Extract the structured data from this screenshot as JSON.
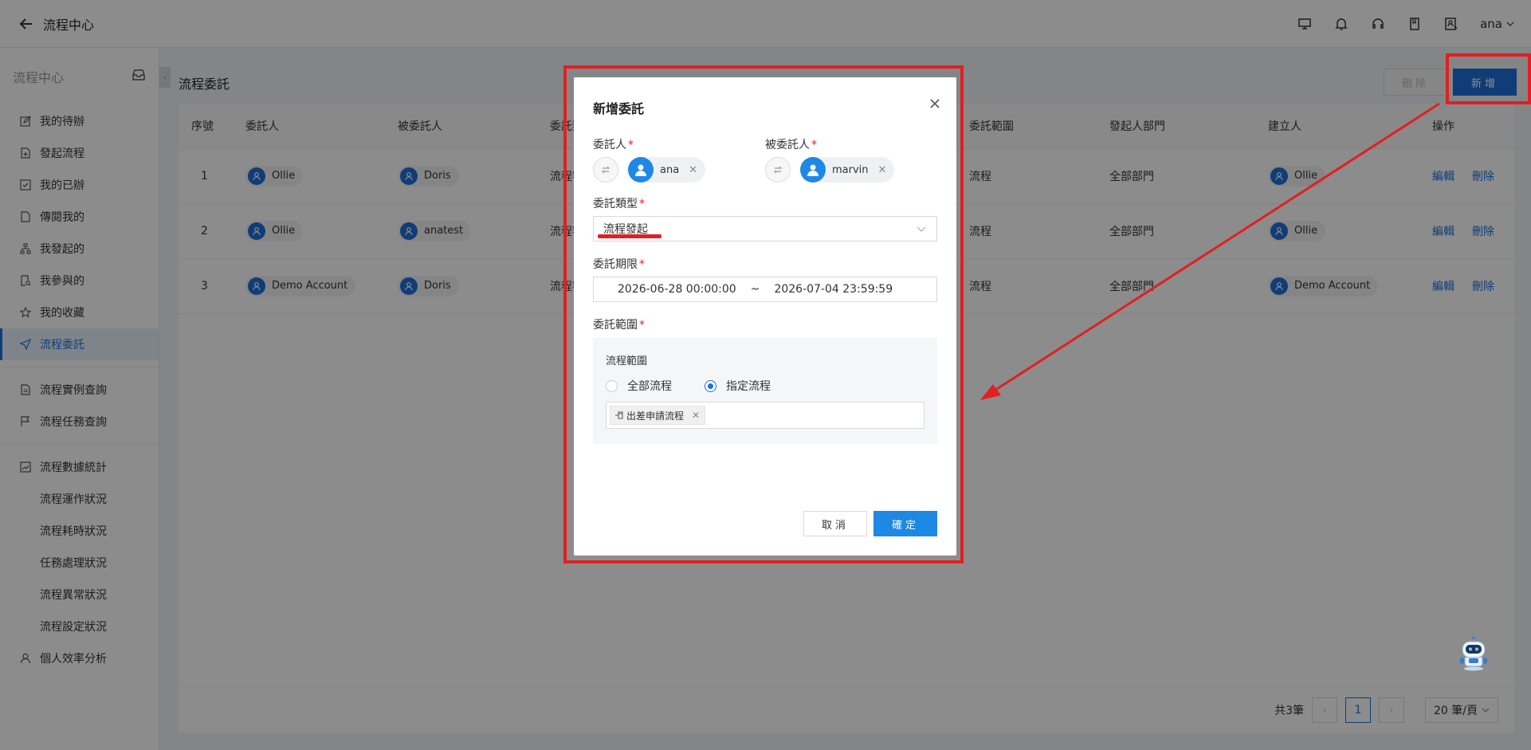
{
  "header": {
    "title": "流程中心",
    "user": "ana"
  },
  "sidebar": {
    "head": "流程中心",
    "items": [
      {
        "label": "我的待辦"
      },
      {
        "label": "發起流程"
      },
      {
        "label": "我的已辦"
      },
      {
        "label": "傳閱我的"
      },
      {
        "label": "我發起的"
      },
      {
        "label": "我參與的"
      },
      {
        "label": "我的收藏"
      },
      {
        "label": "流程委託"
      },
      {
        "label": "流程實例查詢"
      },
      {
        "label": "流程任務查詢"
      },
      {
        "label": "流程數據統計"
      },
      {
        "label": "流程運作狀況"
      },
      {
        "label": "流程耗時狀況"
      },
      {
        "label": "任務處理狀況"
      },
      {
        "label": "流程異常狀況"
      },
      {
        "label": "流程設定狀況"
      },
      {
        "label": "個人效率分析"
      }
    ]
  },
  "page": {
    "title": "流程委託",
    "delete_label": "刪除",
    "add_label": "新增"
  },
  "table": {
    "columns": [
      "序號",
      "委託人",
      "被委託人",
      "委託類型",
      "委託範圍",
      "發起人部門",
      "建立人",
      "操作"
    ],
    "rows": [
      {
        "no": "1",
        "delegator": "Ollie",
        "delegate": "Doris",
        "type": "流程審",
        "scope": "流程",
        "dept": "全部部門",
        "creator": "Ollie",
        "edit": "編輯",
        "del": "刪除"
      },
      {
        "no": "2",
        "delegator": "Ollie",
        "delegate": "anatest",
        "type": "流程審",
        "scope": "流程",
        "dept": "全部部門",
        "creator": "Ollie",
        "edit": "編輯",
        "del": "刪除"
      },
      {
        "no": "3",
        "delegator": "Demo Account",
        "delegate": "Doris",
        "type": "流程審",
        "scope": "流程",
        "dept": "全部部門",
        "creator": "Demo Account",
        "edit": "編輯",
        "del": "刪除"
      }
    ]
  },
  "pager": {
    "total": "共3筆",
    "current": "1",
    "page_size": "20 筆/頁"
  },
  "modal": {
    "title": "新增委託",
    "delegator_label": "委託人",
    "delegator": "ana",
    "delegate_label": "被委託人",
    "delegate": "marvin",
    "type_label": "委託類型",
    "type_value": "流程發起",
    "period_label": "委託期限",
    "start": "2026-06-28 00:00:00",
    "sep": "~",
    "end": "2026-07-04 23:59:59",
    "scope_label": "委託範圍",
    "scope_title": "流程範圍",
    "radio_all": "全部流程",
    "radio_specific": "指定流程",
    "tag": "出差申請流程",
    "cancel": "取消",
    "ok": "確定"
  },
  "colors": {
    "primary": "#1e6fd9",
    "annotation": "#e02020"
  }
}
